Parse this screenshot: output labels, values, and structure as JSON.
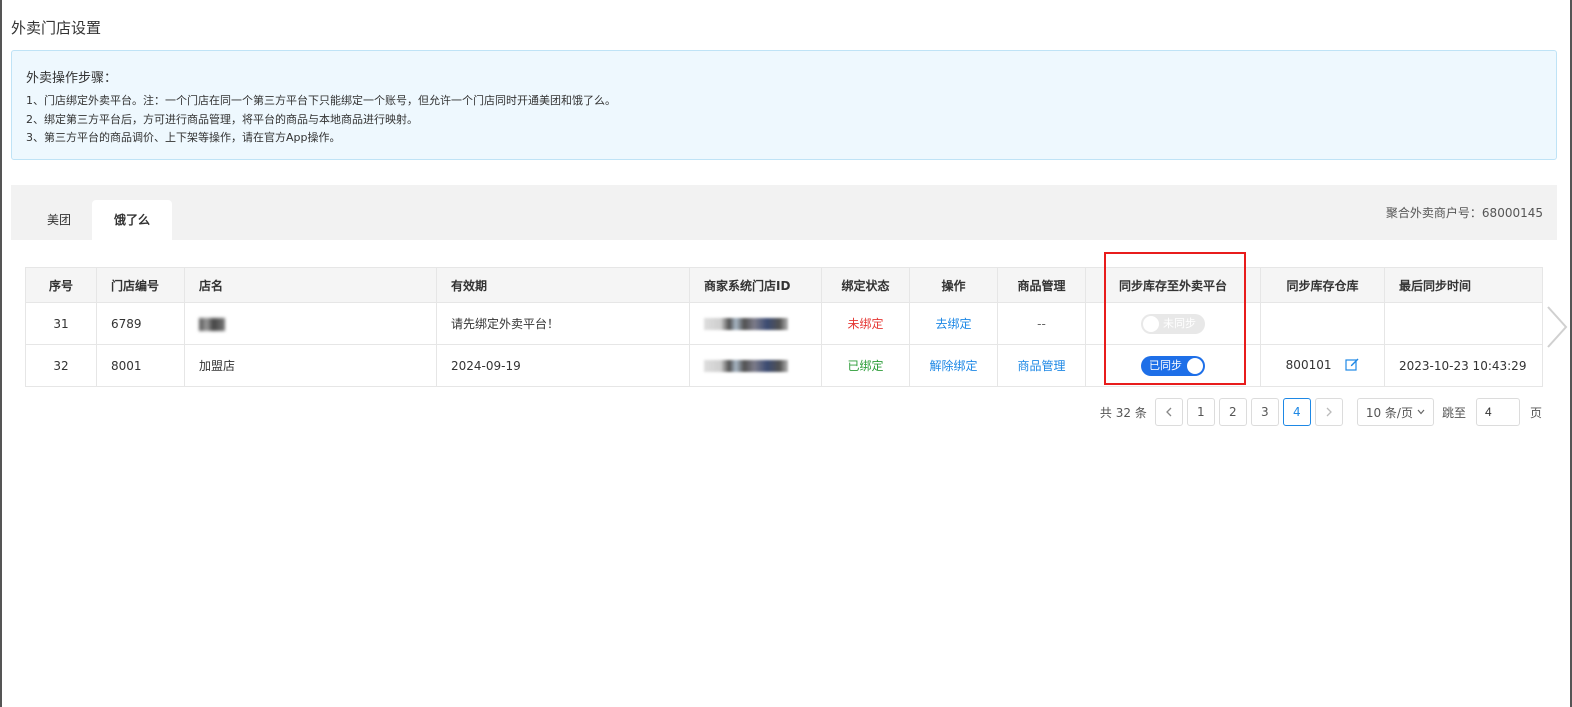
{
  "page": {
    "title": "外卖门店设置"
  },
  "notice": {
    "title": "外卖操作步骤：",
    "lines": [
      "1、门店绑定外卖平台。注：一个门店在同一个第三方平台下只能绑定一个账号，但允许一个门店同时开通美团和饿了么。",
      "2、绑定第三方平台后，方可进行商品管理，将平台的商品与本地商品进行映射。",
      "3、第三方平台的商品调价、上下架等操作，请在官方App操作。"
    ]
  },
  "tabs": [
    {
      "label": "美团",
      "active": false
    },
    {
      "label": "饿了么",
      "active": true
    }
  ],
  "merchant": {
    "label": "聚合外卖商户号：",
    "value": "68000145"
  },
  "table": {
    "headers": [
      "序号",
      "门店编号",
      "店名",
      "有效期",
      "商家系统门店ID",
      "绑定状态",
      "操作",
      "商品管理",
      "同步库存至外卖平台",
      "同步库存仓库",
      "最后同步时间"
    ],
    "rows": [
      {
        "index": "31",
        "store_code": "6789",
        "store_name": "",
        "validity": "请先绑定外卖平台！",
        "system_id": "",
        "status": "未绑定",
        "action": "去绑定",
        "goods": "--",
        "sync_label": "未同步",
        "sync_on": false,
        "warehouse": "",
        "last_sync": ""
      },
      {
        "index": "32",
        "store_code": "8001",
        "store_name": "加盟店",
        "validity": "2024-09-19",
        "system_id": "",
        "status": "已绑定",
        "action": "解除绑定",
        "goods": "商品管理",
        "sync_label": "已同步",
        "sync_on": true,
        "warehouse": "800101",
        "last_sync": "2023-10-23 10:43:29"
      }
    ]
  },
  "pagination": {
    "total": "共 32 条",
    "pages": [
      "1",
      "2",
      "3",
      "4"
    ],
    "current": "4",
    "page_size": "10 条/页",
    "jump_label": "跳至",
    "jump_value": "4",
    "page_suffix": "页"
  },
  "colors": {
    "accent": "#1e88e5",
    "highlight_box": "#e81c1c",
    "unbound": "#e53935",
    "bound": "#2e9d3a",
    "switch_on": "#1e6fe8"
  }
}
